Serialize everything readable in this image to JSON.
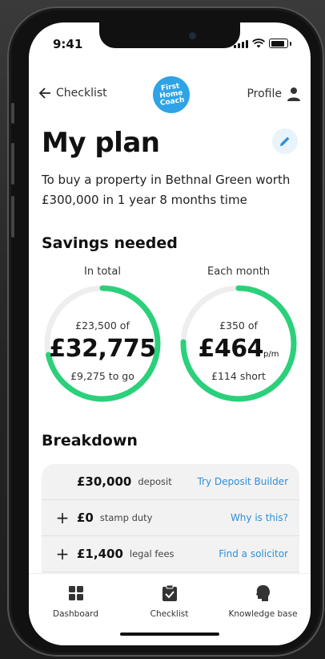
{
  "status": {
    "time": "9:41"
  },
  "nav": {
    "back_label": "Checklist",
    "logo_text": "First Home Coach",
    "profile_label": "Profile"
  },
  "plan": {
    "title": "My plan",
    "description": "To buy a property in Bethnal Green worth £300,000 in 1 year 8 months time"
  },
  "savings": {
    "heading": "Savings needed",
    "total": {
      "label": "In total",
      "saved": "£23,500 of",
      "amount": "£32,775",
      "remaining": "£9,275 to go",
      "progress": 0.717
    },
    "monthly": {
      "label": "Each month",
      "saved": "£350 of",
      "amount": "£464",
      "unit": "p/m",
      "remaining": "£114 short",
      "progress": 0.754
    }
  },
  "breakdown": {
    "heading": "Breakdown",
    "rows": [
      {
        "prefix": "",
        "amount": "£30,000",
        "label": "deposit",
        "link": "Try Deposit Builder"
      },
      {
        "prefix": "+",
        "amount": "£0",
        "label": "stamp duty",
        "link": "Why is this?"
      },
      {
        "prefix": "+",
        "amount": "£1,400",
        "label": "legal fees",
        "link": "Find a solicitor"
      }
    ]
  },
  "tabbar": {
    "tabs": [
      {
        "label": "Dashboard",
        "icon": "grid-icon"
      },
      {
        "label": "Checklist",
        "icon": "clipboard-icon"
      },
      {
        "label": "Knowledge base",
        "icon": "head-icon"
      }
    ]
  },
  "colors": {
    "accent": "#2bd07a",
    "track": "#eeeeee",
    "link": "#2e8fd8",
    "brand": "#2ea3e6"
  }
}
